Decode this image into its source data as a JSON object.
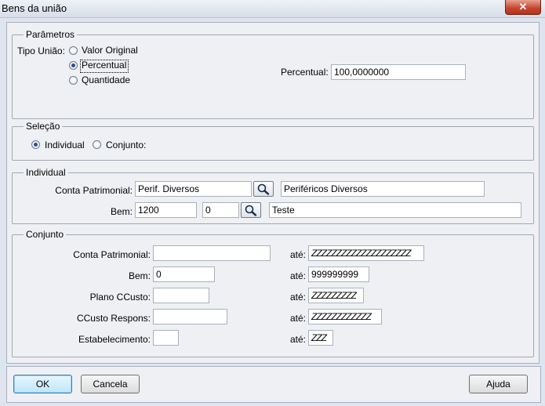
{
  "window": {
    "title": "Bens da união",
    "close_glyph": "✕"
  },
  "parametros": {
    "legend": "Parâmetros",
    "tipo_uniao_label": "Tipo União:",
    "options": [
      {
        "label": "Valor Original",
        "selected": false
      },
      {
        "label": "Percentual",
        "selected": true
      },
      {
        "label": "Quantidade",
        "selected": false
      }
    ],
    "percentual_label": "Percentual:",
    "percentual_value": "100,0000000"
  },
  "selecao": {
    "legend": "Seleção",
    "options": [
      {
        "label": "Individual",
        "selected": true
      },
      {
        "label": "Conjunto:",
        "selected": false
      }
    ]
  },
  "individual": {
    "legend": "Individual",
    "conta_label": "Conta Patrimonial:",
    "conta_value": "Perif. Diversos",
    "conta_desc": "Periféricos Diversos",
    "bem_label": "Bem:",
    "bem_value": "1200",
    "bem_seq": "0",
    "bem_desc": "Teste"
  },
  "conjunto": {
    "legend": "Conjunto",
    "ate_label": "até:",
    "rows": [
      {
        "label": "Conta Patrimonial:",
        "from": "",
        "to": "ZZZZZZZZZZZZZZZZZZZZ"
      },
      {
        "label": "Bem:",
        "from": "0",
        "to": "999999999"
      },
      {
        "label": "Plano CCusto:",
        "from": "",
        "to": "ZZZZZZZZZ"
      },
      {
        "label": "CCusto Respons:",
        "from": "",
        "to": "ZZZZZZZZZZZZ"
      },
      {
        "label": "Estabelecimento:",
        "from": "",
        "to": "ZZZ"
      }
    ]
  },
  "buttons": {
    "ok": "OK",
    "cancel": "Cancela",
    "help": "Ajuda"
  },
  "icons": {
    "lookup": "magnifier-icon"
  },
  "colors": {
    "window_bg": "#dfe5ef",
    "client_bg": "#eef0f4",
    "close": "#c5432c"
  }
}
